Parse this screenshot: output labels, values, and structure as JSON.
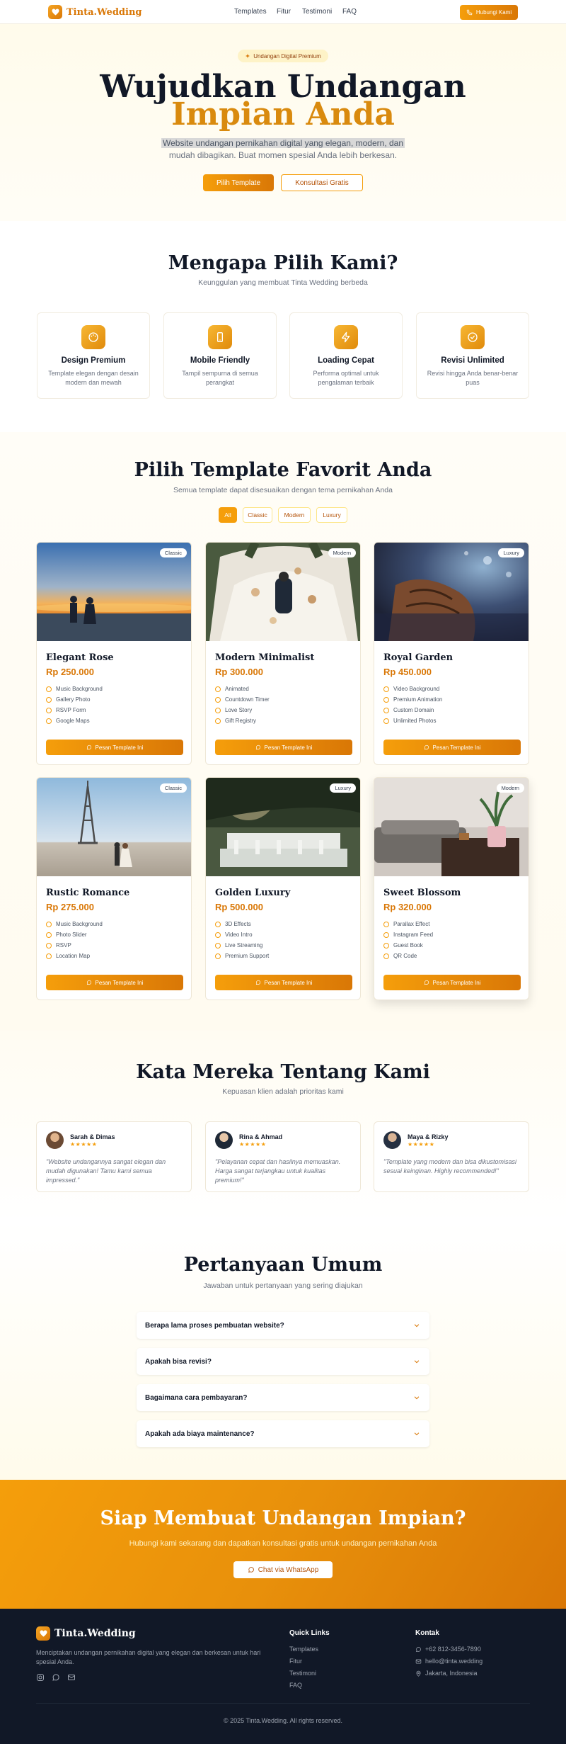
{
  "nav": {
    "brand": "Tinta.Wedding",
    "links": [
      "Templates",
      "Fitur",
      "Testimoni",
      "FAQ"
    ],
    "cta": "Hubungi Kami"
  },
  "hero": {
    "badge": "Undangan Digital Premium",
    "title_line1": "Wujudkan Undangan",
    "title_line2": "Impian Anda",
    "subtitle_line1": "Website undangan pernikahan digital yang elegan, modern, dan",
    "subtitle_line2": "mudah dibagikan. Buat momen spesial Anda lebih berkesan.",
    "btn_primary": "Pilih Template",
    "btn_secondary": "Konsultasi Gratis"
  },
  "features": {
    "title": "Mengapa Pilih Kami?",
    "subtitle": "Keunggulan yang membuat Tinta Wedding berbeda",
    "items": [
      {
        "title": "Design Premium",
        "desc": "Template elegan dengan desain modern dan mewah",
        "icon": "palette-icon"
      },
      {
        "title": "Mobile Friendly",
        "desc": "Tampil sempurna di semua perangkat",
        "icon": "smartphone-icon"
      },
      {
        "title": "Loading Cepat",
        "desc": "Performa optimal untuk pengalaman terbaik",
        "icon": "lightning-icon"
      },
      {
        "title": "Revisi Unlimited",
        "desc": "Revisi hingga Anda benar-benar puas",
        "icon": "check-circle-icon"
      }
    ]
  },
  "templates": {
    "title": "Pilih Template Favorit Anda",
    "subtitle": "Semua template dapat disesuaikan dengan tema pernikahan Anda",
    "filters": [
      "All",
      "Classic",
      "Modern",
      "Luxury"
    ],
    "active_filter": "All",
    "button_label": "Pesan Template Ini",
    "items": [
      {
        "name": "Elegant Rose",
        "price": "Rp 250.000",
        "badge": "Classic",
        "features": [
          "Music Background",
          "Gallery Photo",
          "RSVP Form",
          "Google Maps"
        ]
      },
      {
        "name": "Modern Minimalist",
        "price": "Rp 300.000",
        "badge": "Modern",
        "features": [
          "Animated",
          "Countdown Timer",
          "Love Story",
          "Gift Registry"
        ]
      },
      {
        "name": "Royal Garden",
        "price": "Rp 450.000",
        "badge": "Luxury",
        "features": [
          "Video Background",
          "Premium Animation",
          "Custom Domain",
          "Unlimited Photos"
        ]
      },
      {
        "name": "Rustic Romance",
        "price": "Rp 275.000",
        "badge": "Classic",
        "features": [
          "Music Background",
          "Photo Slider",
          "RSVP",
          "Location Map"
        ]
      },
      {
        "name": "Golden Luxury",
        "price": "Rp 500.000",
        "badge": "Luxury",
        "features": [
          "3D Effects",
          "Video Intro",
          "Live Streaming",
          "Premium Support"
        ]
      },
      {
        "name": "Sweet Blossom",
        "price": "Rp 320.000",
        "badge": "Modern",
        "features": [
          "Parallax Effect",
          "Instagram Feed",
          "Guest Book",
          "QR Code"
        ]
      }
    ]
  },
  "testimonials": {
    "title": "Kata Mereka Tentang Kami",
    "subtitle": "Kepuasan klien adalah prioritas kami",
    "stars": "★★★★★",
    "items": [
      {
        "name": "Sarah & Dimas",
        "quote": "\"Website undangannya sangat elegan dan mudah digunakan! Tamu kami semua impressed.\""
      },
      {
        "name": "Rina & Ahmad",
        "quote": "\"Pelayanan cepat dan hasilnya memuaskan. Harga sangat terjangkau untuk kualitas premium!\""
      },
      {
        "name": "Maya & Rizky",
        "quote": "\"Template yang modern dan bisa dikustomisasi sesuai keinginan. Highly recommended!\""
      }
    ]
  },
  "faq": {
    "title": "Pertanyaan Umum",
    "subtitle": "Jawaban untuk pertanyaan yang sering diajukan",
    "items": [
      "Berapa lama proses pembuatan website?",
      "Apakah bisa revisi?",
      "Bagaimana cara pembayaran?",
      "Apakah ada biaya maintenance?"
    ]
  },
  "cta": {
    "title": "Siap Membuat Undangan Impian?",
    "subtitle": "Hubungi kami sekarang dan dapatkan konsultasi gratis untuk undangan pernikahan Anda",
    "button": "Chat via WhatsApp"
  },
  "footer": {
    "brand": "Tinta.Wedding",
    "desc_line1": "Menciptakan undangan pernikahan digital yang elegan dan berkesan untuk hari",
    "desc_line2": "spesial Anda.",
    "quick_links_title": "Quick Links",
    "quick_links": [
      "Templates",
      "Fitur",
      "Testimoni",
      "FAQ"
    ],
    "contact_title": "Kontak",
    "phone": "+62 812-3456-7890",
    "email": "hello@tinta.wedding",
    "location": "Jakarta, Indonesia",
    "copyright": "© 2025 Tinta.Wedding. All rights reserved."
  },
  "colors": {
    "accent": "#f59e0b",
    "accent_dark": "#d97706",
    "footer_bg": "#111827"
  }
}
